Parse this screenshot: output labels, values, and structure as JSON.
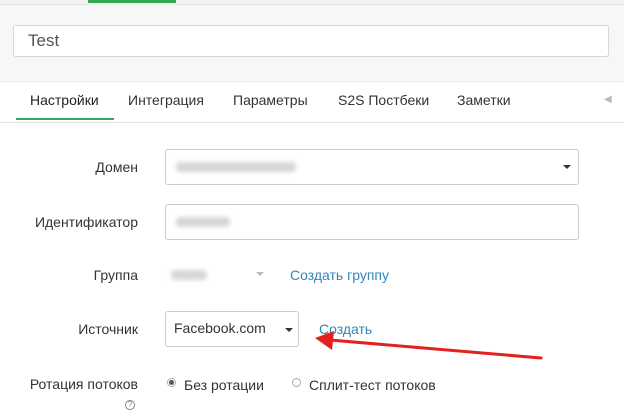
{
  "name_field": {
    "value": "Test"
  },
  "tabs": [
    {
      "label": "Настройки",
      "active": true
    },
    {
      "label": "Интеграция"
    },
    {
      "label": "Параметры"
    },
    {
      "label": "S2S Постбеки"
    },
    {
      "label": "Заметки"
    }
  ],
  "form": {
    "domain_label": "Домен",
    "identifier_label": "Идентификатор",
    "group_label": "Группа",
    "create_group_link": "Создать группу",
    "source_label": "Источник",
    "source_value": "Facebook.com",
    "create_link": "Создать",
    "rotation_label": "Ротация потоков",
    "rotation_options": [
      "Без ротации",
      "Сплит-тест потоков"
    ],
    "rotation_selected": "Без ротации"
  },
  "annotation_arrow_color": "#e3201b",
  "accent_color": "#3aa655"
}
